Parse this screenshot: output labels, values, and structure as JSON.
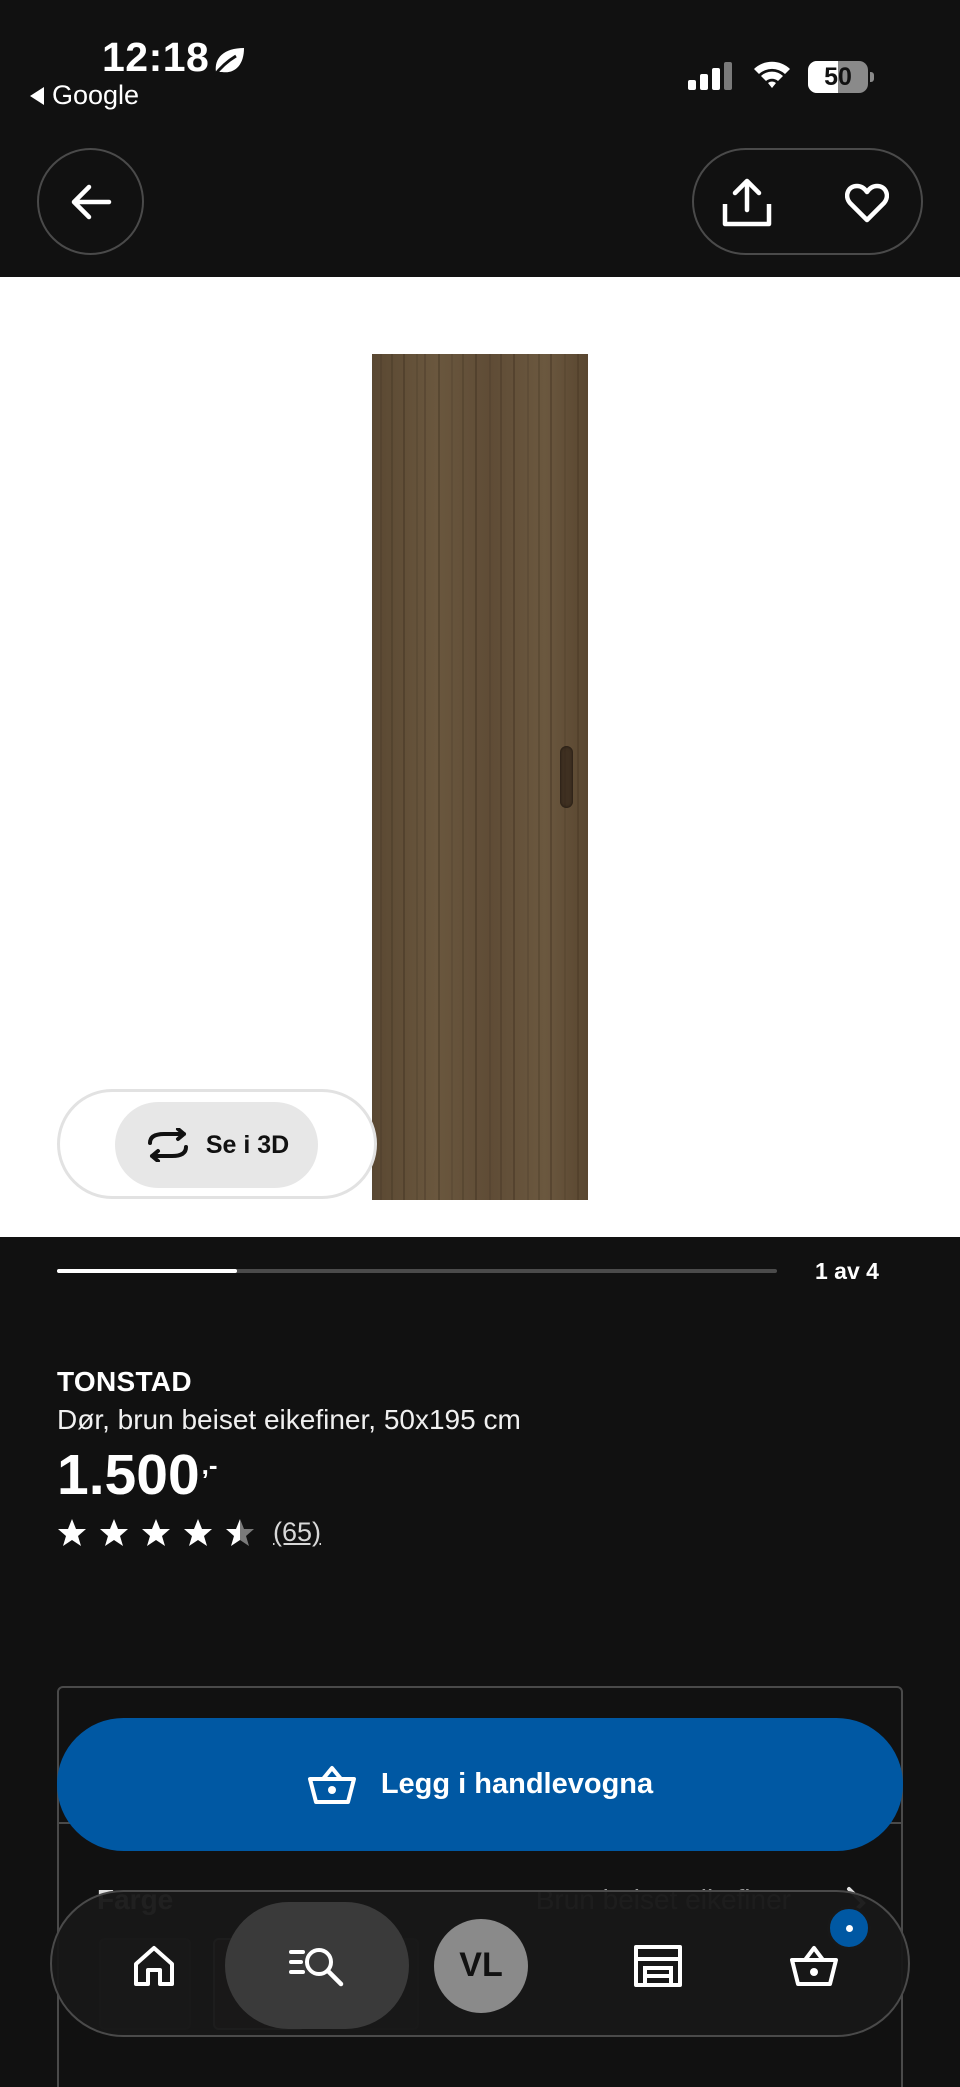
{
  "status_bar": {
    "time": "12:18",
    "back_app": "Google",
    "battery": "50",
    "battery_level": 0.5
  },
  "gallery": {
    "view_3d_label": "Se i 3D",
    "pager_label": "1 av 4",
    "current": 1,
    "total": 4
  },
  "product": {
    "name": "TONSTAD",
    "description": "Dør, brun beiset eikefiner, 50x195 cm",
    "price": "1.500",
    "price_suffix": ",-",
    "rating": 4.5,
    "rating_count": "(65)"
  },
  "options": {
    "color_label": "Farge",
    "color_value": "Brun beiset eikefiner"
  },
  "cart_button": {
    "label": "Legg i handlevogna"
  },
  "bottom_nav": {
    "profile_initials": "VL",
    "icons": [
      "home-icon",
      "search-icon",
      "profile-avatar",
      "store-icon",
      "cart-icon"
    ]
  },
  "colors": {
    "background": "#111111",
    "accent_blue": "#0058a3",
    "wood": "#5f4c36"
  }
}
